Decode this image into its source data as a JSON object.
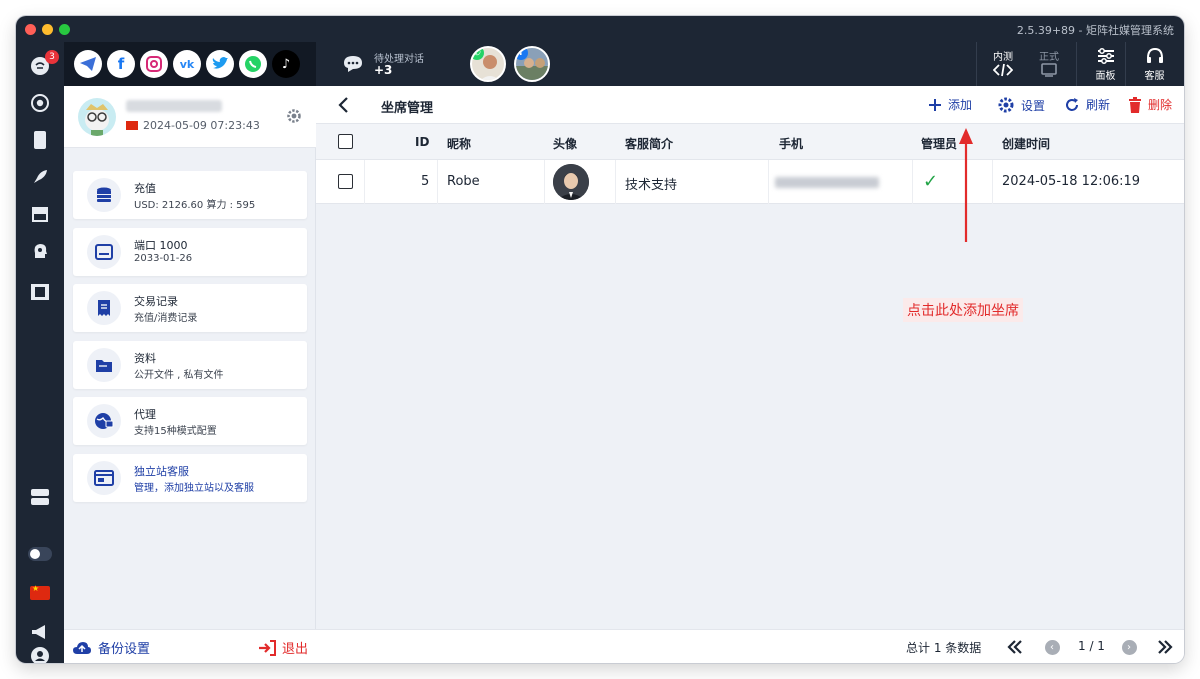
{
  "window": {
    "title": "2.5.39+89 - 矩阵社媒管理系统"
  },
  "rail": {
    "badge_count": "3",
    "icons": [
      "chat-icon",
      "chrome-icon",
      "phone-icon",
      "rocket-icon",
      "store-icon",
      "ai-head-icon",
      "film-icon",
      "server-icon",
      "toggle-icon",
      "china-flag-icon",
      "megaphone-icon",
      "user-icon"
    ]
  },
  "topbar": {
    "social_icons": [
      "telegram-icon",
      "facebook-icon",
      "instagram-icon",
      "vk-icon",
      "twitter-icon",
      "whatsapp-icon",
      "tiktok-icon"
    ],
    "pending_label": "待处理对话",
    "pending_count": "+3",
    "env_test": "内测",
    "env_prod": "正式",
    "panel_label": "面板",
    "support_label": "客服"
  },
  "sidebar": {
    "profile_date": "2024-05-09 07:23:43",
    "cards": [
      {
        "title": "充值",
        "sub": "USD: 2126.60  算力 : 595",
        "icon": "coins-icon"
      },
      {
        "title": "端口 1000",
        "sub": "2033-01-26",
        "icon": "port-icon"
      },
      {
        "title": "交易记录",
        "sub": "充值/消费记录",
        "icon": "receipt-icon"
      },
      {
        "title": "资料",
        "sub": "公开文件 , 私有文件",
        "icon": "folder-icon"
      },
      {
        "title": "代理",
        "sub": "支持15种模式配置",
        "icon": "globe-lock-icon"
      },
      {
        "title": "独立站客服",
        "sub": "管理，添加独立站以及客服",
        "icon": "website-icon"
      }
    ],
    "backup_label": "备份设置",
    "logout_label": "退出"
  },
  "main": {
    "title": "坐席管理",
    "actions": {
      "add": "添加",
      "settings": "设置",
      "refresh": "刷新",
      "delete": "删除"
    },
    "columns": [
      "ID",
      "昵称",
      "头像",
      "客服简介",
      "手机",
      "管理员",
      "创建时间"
    ],
    "rows": [
      {
        "id": "5",
        "nickname": "Robe",
        "intro": "技术支持",
        "admin": "✓",
        "created": "2024-05-18 12:06:19"
      }
    ],
    "annotation": "点击此处添加坐席",
    "total": "总计 1 条数据",
    "page": "1 / 1"
  },
  "colors": {
    "dark": "#1d2634",
    "accent": "#1f3fa6",
    "danger": "#e22b2b",
    "success": "#22a447"
  }
}
